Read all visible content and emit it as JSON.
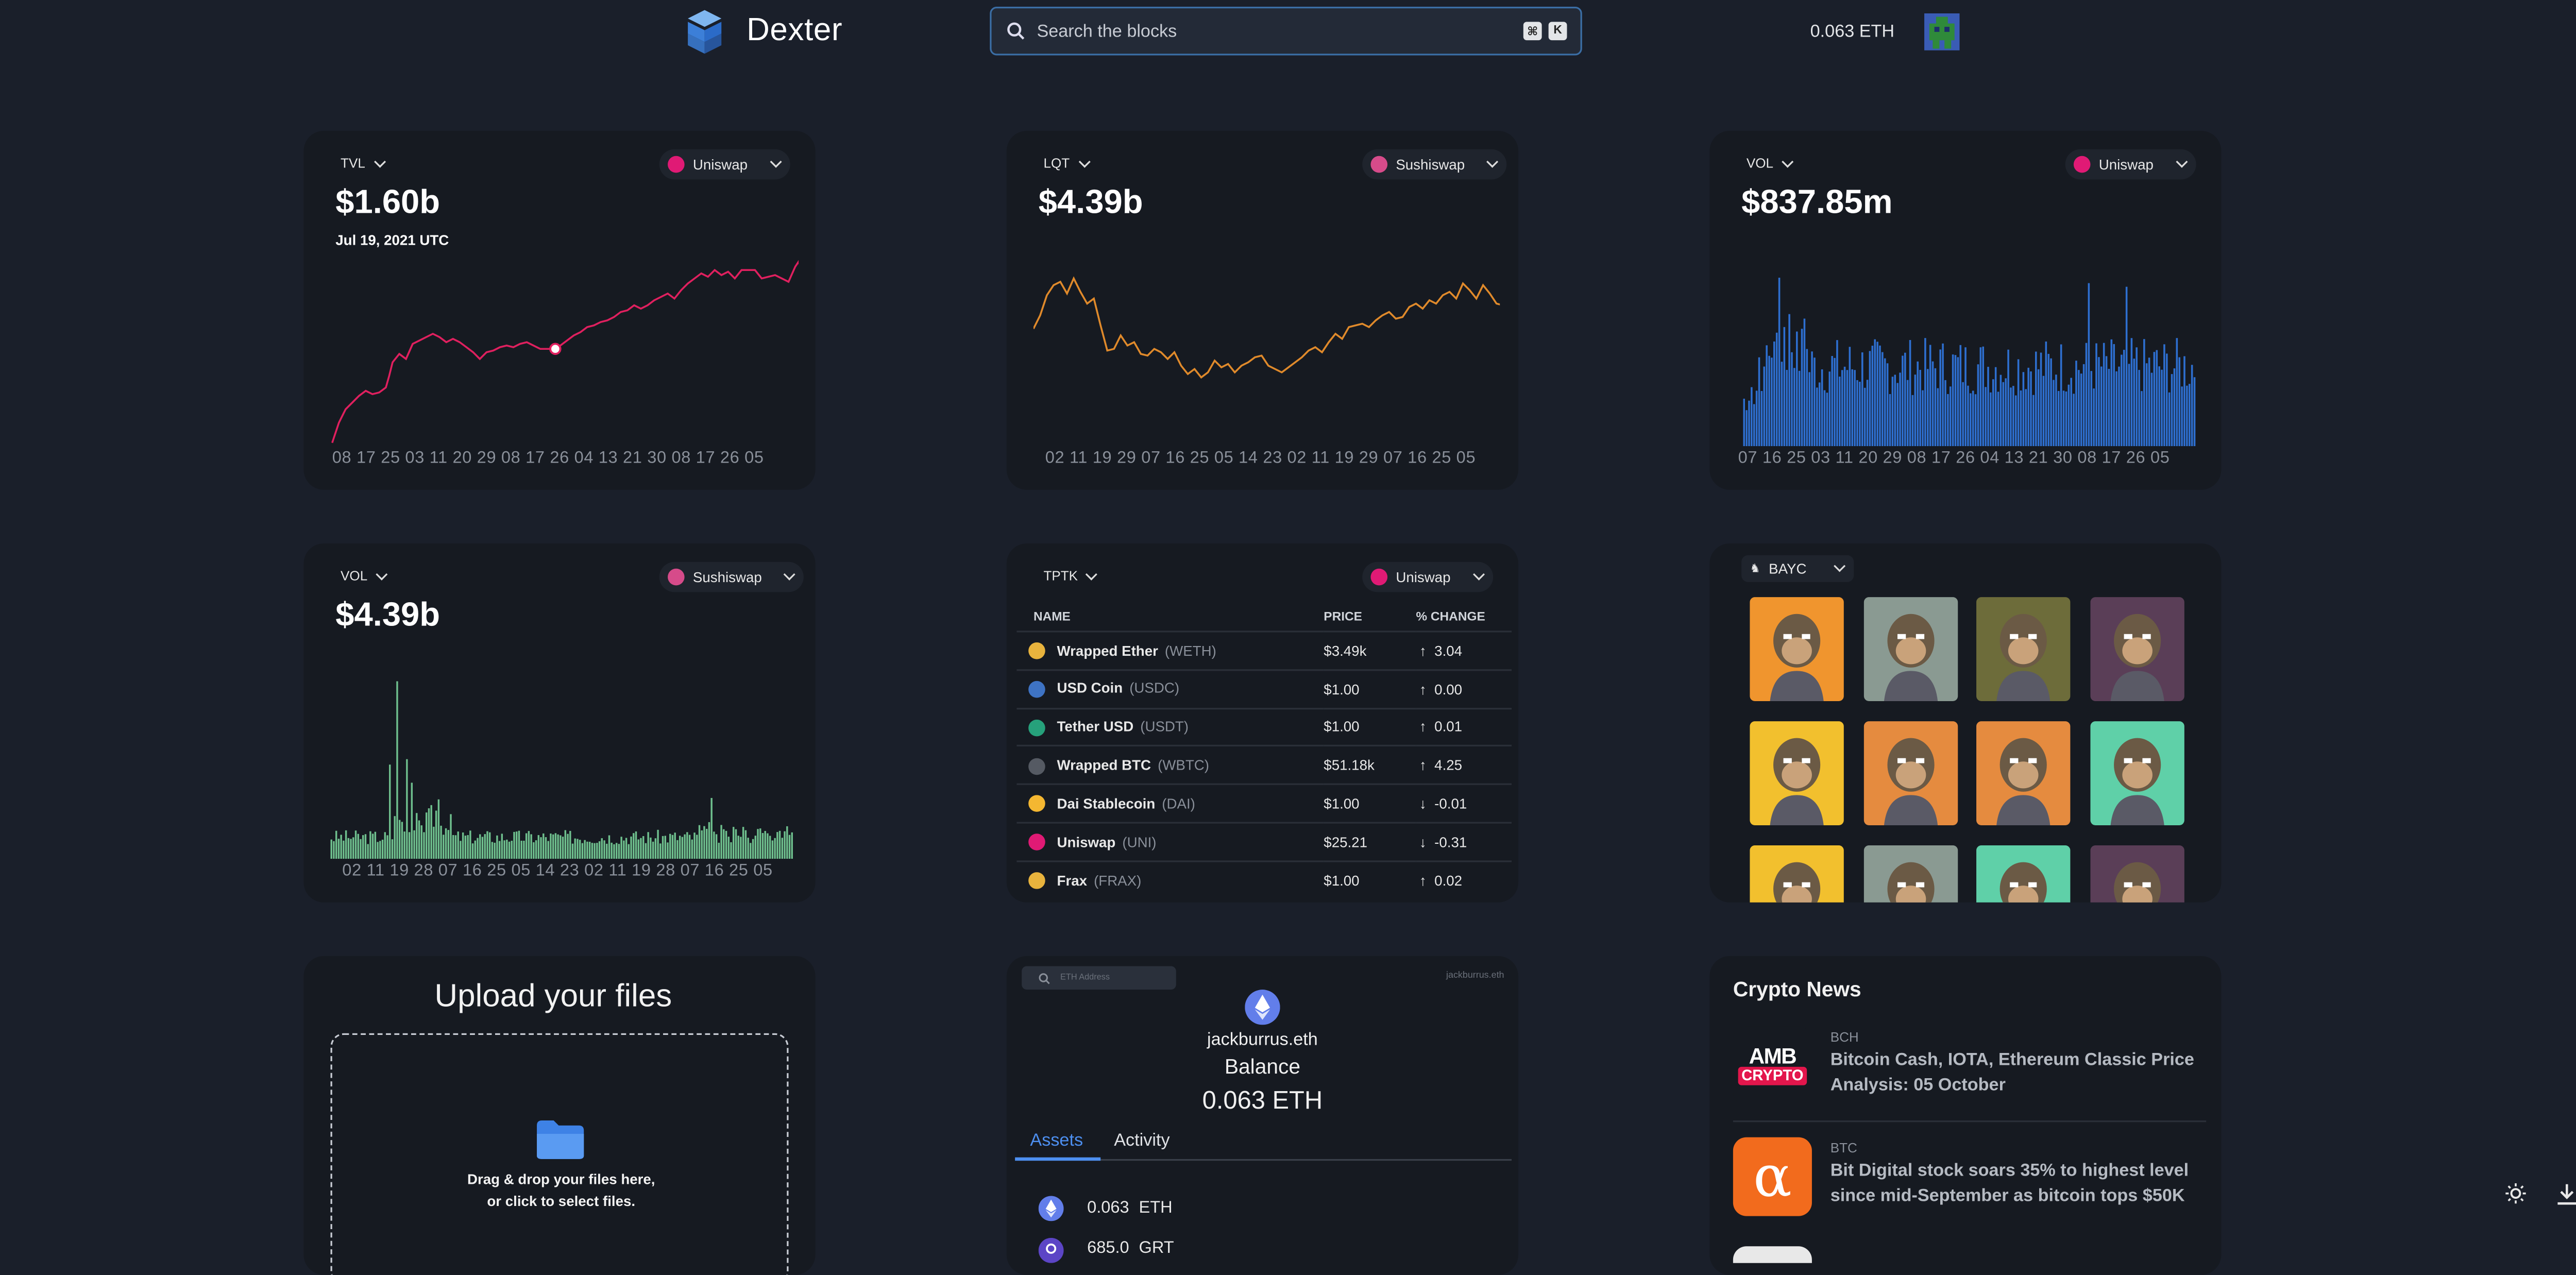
{
  "header": {
    "brand": "Dexter",
    "search_placeholder": "Search the blocks",
    "search_kbd_1": "⌘",
    "search_kbd_2": "K",
    "balance": "0.063 ETH"
  },
  "cards": {
    "tvl": {
      "selector": "TVL",
      "dex": "Uniswap",
      "value": "$1.60b",
      "date": "Jul 19, 2021 UTC",
      "axis": "08 17 25 03 11 20 29 08 17 26 04 13 21 30 08 17 26 05"
    },
    "lqt": {
      "selector": "LQT",
      "dex": "Sushiswap",
      "value": "$4.39b",
      "axis": "02 11 19 29 07 16 25 05 14 23 02 11 19 29 07 16 25 05"
    },
    "vol_uni": {
      "selector": "VOL",
      "dex": "Uniswap",
      "value": "$837.85m",
      "axis": "07 16 25 03 11 20 29 08 17 26 04 13 21 30 08 17 26 05"
    },
    "vol_sushi": {
      "selector": "VOL",
      "dex": "Sushiswap",
      "value": "$4.39b",
      "axis": "02 11 19 28 07 16 25 05 14 23 02 11 19 28 07 16 25 05"
    },
    "tptk": {
      "selector": "TPTK",
      "dex": "Uniswap",
      "columns": [
        "NAME",
        "PRICE",
        "% CHANGE"
      ],
      "rows": [
        {
          "name": "Wrapped Ether",
          "symbol": "(WETH)",
          "price": "$3.49k",
          "arrow": "↑",
          "change": "3.04",
          "dir": "up",
          "color": "#e8b33d"
        },
        {
          "name": "USD Coin",
          "symbol": "(USDC)",
          "price": "$1.00",
          "arrow": "↑",
          "change": "0.00",
          "dir": "up",
          "color": "#3e73c4"
        },
        {
          "name": "Tether USD",
          "symbol": "(USDT)",
          "price": "$1.00",
          "arrow": "↑",
          "change": "0.01",
          "dir": "up",
          "color": "#26a17b"
        },
        {
          "name": "Wrapped BTC",
          "symbol": "(WBTC)",
          "price": "$51.18k",
          "arrow": "↑",
          "change": "4.25",
          "dir": "up",
          "color": "#555a63"
        },
        {
          "name": "Dai Stablecoin",
          "symbol": "(DAI)",
          "price": "$1.00",
          "arrow": "↓",
          "change": "-0.01",
          "dir": "down",
          "color": "#f4b731"
        },
        {
          "name": "Uniswap",
          "symbol": "(UNI)",
          "price": "$25.21",
          "arrow": "↓",
          "change": "-0.31",
          "dir": "down",
          "color": "#e01a75"
        },
        {
          "name": "Frax",
          "symbol": "(FRAX)",
          "price": "$1.00",
          "arrow": "↑",
          "change": "0.02",
          "dir": "up",
          "color": "#e8b33d"
        }
      ]
    },
    "nft": {
      "collection": "BAYC",
      "tiles": [
        "#f0952e",
        "#8a9a92",
        "#6d6c3a",
        "#5a3e57",
        "#f2c02e",
        "#e58b3f",
        "#e58b3f",
        "#5fd0a8",
        "#f2c02e",
        "#8a9a92",
        "#5fd0a8",
        "#5a3e57"
      ]
    },
    "upload": {
      "title": "Upload your files",
      "line1": "Drag & drop your files here,",
      "line2": "or click to select files."
    },
    "wallet": {
      "search_placeholder": "ETH Address",
      "account_small": "jackburrus.eth",
      "account": "jackburrus.eth",
      "balance_label": "Balance",
      "balance": "0.063 ETH",
      "tabs": [
        "Assets",
        "Activity"
      ],
      "assets": [
        {
          "amount": "0.063",
          "symbol": "ETH"
        },
        {
          "amount": "685.0",
          "symbol": "GRT"
        }
      ]
    },
    "news": {
      "title": "Crypto News",
      "items": [
        {
          "tag": "BCH",
          "title": "Bitcoin Cash, IOTA, Ethereum Classic Price Analysis: 05 October",
          "logo_line1": "AMB",
          "logo_line2": "CRYPTO"
        },
        {
          "tag": "BTC",
          "title": "Bit Digital stock soars 35% to highest level since mid-September as bitcoin tops $50K",
          "logo_line1": "α"
        }
      ]
    }
  }
}
